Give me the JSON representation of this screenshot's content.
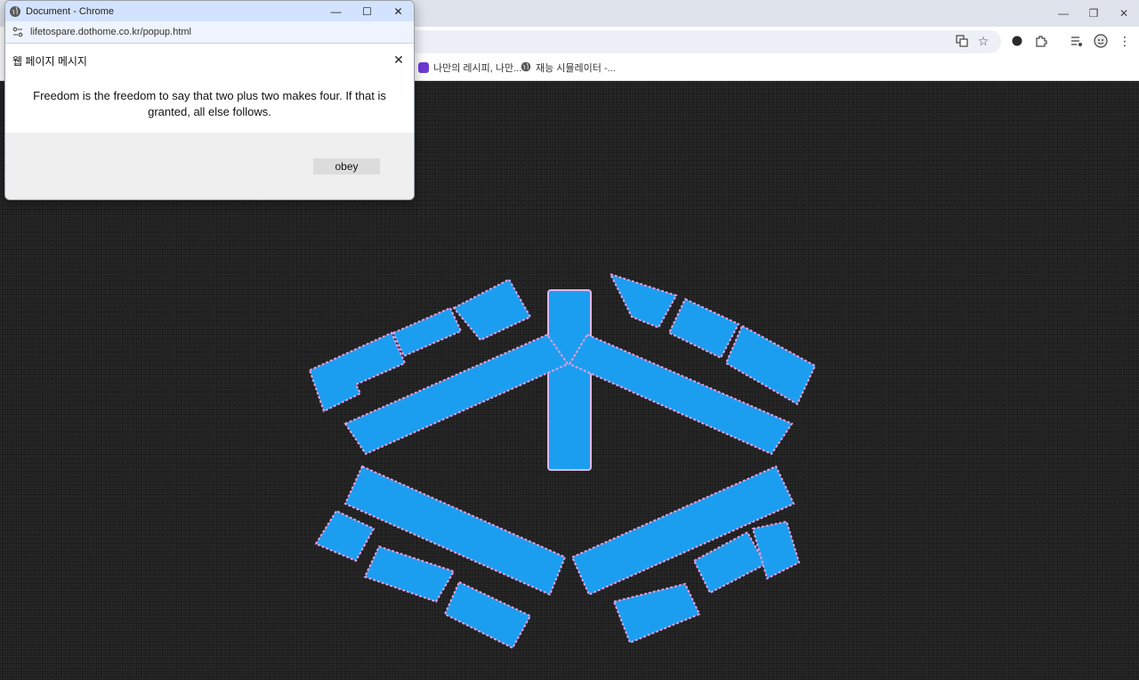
{
  "main_window": {
    "controls": {
      "minimize": "—",
      "restore": "❐",
      "close": "✕"
    },
    "toolbar_icons": [
      "translate-icon",
      "star-icon",
      "profile-dot-icon",
      "extensions-icon",
      "media-icon",
      "avatar-icon",
      "menu-icon"
    ],
    "bookmarks": [
      {
        "label": "나만의 레시피, 나만...",
        "color": "#6e3ad6"
      },
      {
        "label": "재능 시뮬레이터 -...",
        "color": "#555555"
      }
    ]
  },
  "popup": {
    "title": "Document - Chrome",
    "url": "lifetospare.dothome.co.kr/popup.html",
    "controls": {
      "minimize": "—",
      "maximize": "☐",
      "close": "✕"
    }
  },
  "dialog": {
    "title": "웹 페이지 메시지",
    "message": "Freedom is the freedom to say that two plus two makes four. If that is granted, all else follows.",
    "button_label": "obey",
    "close_glyph": "✕"
  },
  "colors": {
    "logo_blue": "#1c9ef0",
    "logo_edge": "#e49ee0",
    "page_bg": "#202020",
    "popup_title_bg": "#d3e3fd"
  }
}
